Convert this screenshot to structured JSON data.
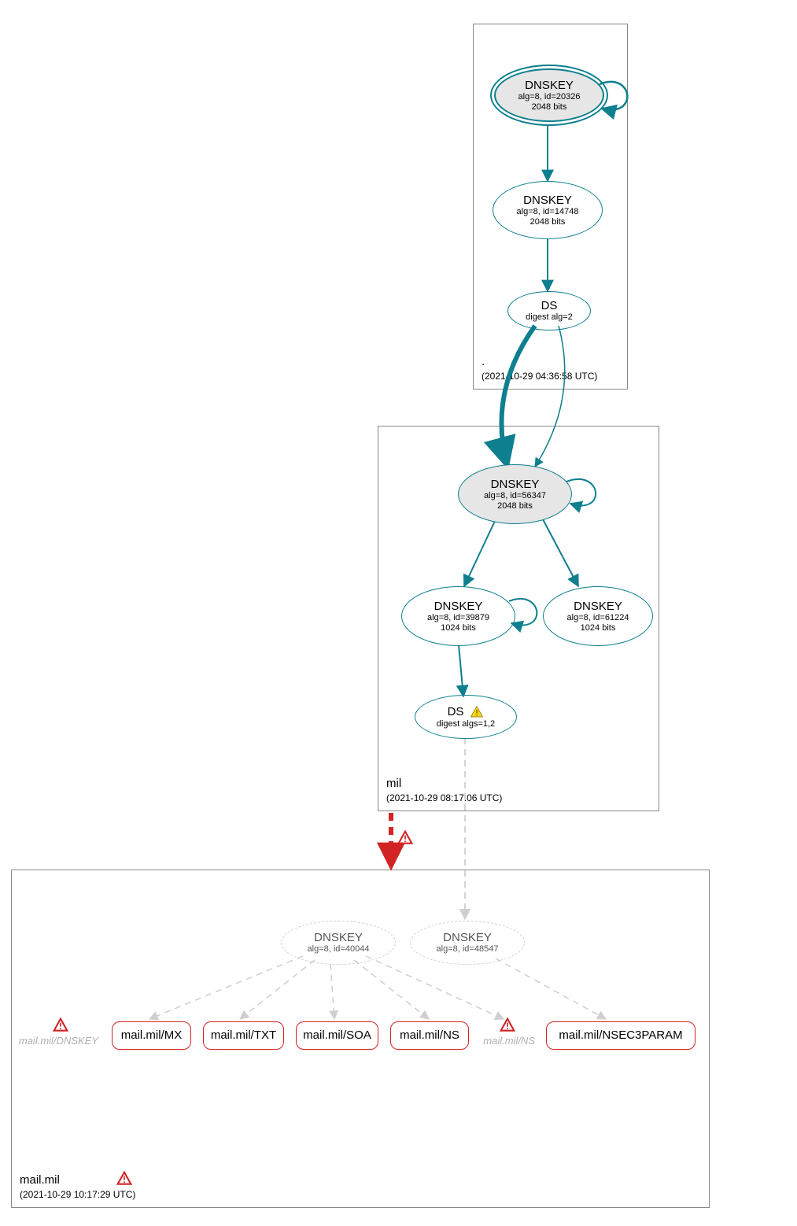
{
  "colors": {
    "teal": "#0e7f8e",
    "red": "#d22424",
    "ghost": "#cfcfcf",
    "zone_border": "#888888"
  },
  "zones": {
    "root": {
      "name": ".",
      "timestamp": "(2021-10-29 04:36:58 UTC)"
    },
    "mil": {
      "name": "mil",
      "timestamp": "(2021-10-29 08:17:06 UTC)"
    },
    "mailmil": {
      "name": "mail.mil",
      "timestamp": "(2021-10-29 10:17:29 UTC)"
    }
  },
  "nodes": {
    "root_ksk": {
      "title": "DNSKEY",
      "line2": "alg=8, id=20326",
      "line3": "2048 bits"
    },
    "root_zsk": {
      "title": "DNSKEY",
      "line2": "alg=8, id=14748",
      "line3": "2048 bits"
    },
    "root_ds": {
      "title": "DS",
      "line2": "digest alg=2"
    },
    "mil_ksk": {
      "title": "DNSKEY",
      "line2": "alg=8, id=56347",
      "line3": "2048 bits"
    },
    "mil_zsk1": {
      "title": "DNSKEY",
      "line2": "alg=8, id=39879",
      "line3": "1024 bits"
    },
    "mil_zsk2": {
      "title": "DNSKEY",
      "line2": "alg=8, id=61224",
      "line3": "1024 bits"
    },
    "mil_ds": {
      "title": "DS",
      "line2": "digest algs=1,2"
    },
    "mm_k1": {
      "title": "DNSKEY",
      "line2": "alg=8, id=40044"
    },
    "mm_k2": {
      "title": "DNSKEY",
      "line2": "alg=8, id=48547"
    },
    "rr_mx": {
      "label": "mail.mil/MX"
    },
    "rr_txt": {
      "label": "mail.mil/TXT"
    },
    "rr_soa": {
      "label": "mail.mil/SOA"
    },
    "rr_ns": {
      "label": "mail.mil/NS"
    },
    "rr_nsec3": {
      "label": "mail.mil/NSEC3PARAM"
    },
    "ghost_dnskey": {
      "label": "mail.mil/DNSKEY"
    },
    "ghost_ns": {
      "label": "mail.mil/NS"
    }
  }
}
